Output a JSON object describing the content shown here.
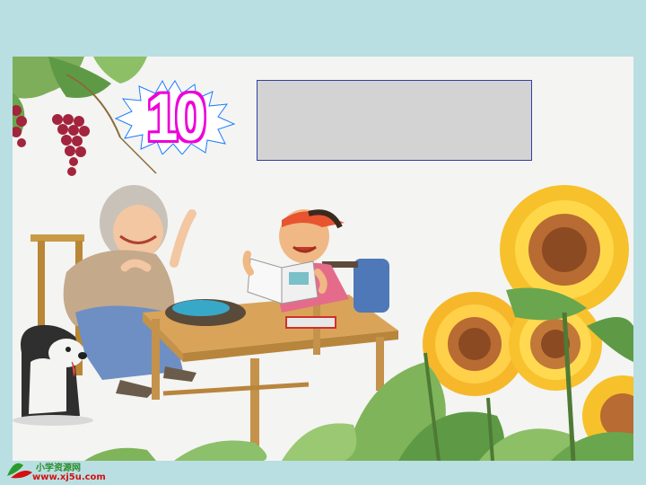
{
  "slide": {
    "lesson_number": "10",
    "title_box_text": ""
  },
  "colors": {
    "background": "#b9dfe2",
    "badge_fill": "#ee00d8",
    "badge_burst": "#1a7cff",
    "title_box": "#d3d3d3"
  },
  "illustration": {
    "description_icons": [
      "grapes-icon",
      "grandmother-figure",
      "boy-figure",
      "dog-figure",
      "table",
      "sunflower-icon"
    ]
  },
  "watermark": {
    "line1": "小学资源网",
    "line2": "www.xj5u.com"
  }
}
